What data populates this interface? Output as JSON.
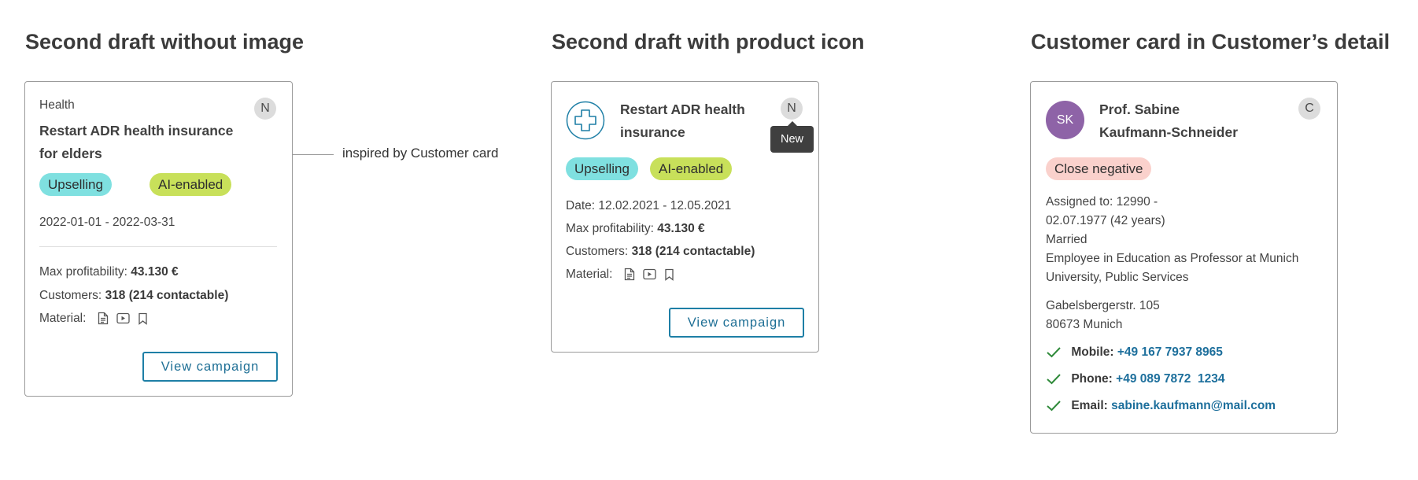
{
  "sections": [
    {
      "title": "Second draft without image"
    },
    {
      "title": "Second draft with product icon"
    },
    {
      "title": "Customer card in Customer’s detail"
    }
  ],
  "annotation": {
    "text": "inspired by Customer card"
  },
  "card1": {
    "category": "Health",
    "badge": "N",
    "title_line1": "Restart ADR health insurance",
    "title_line2": "for elders",
    "tags": [
      "Upselling",
      "AI-enabled"
    ],
    "date_range": "2022-01-01 - 2022-03-31",
    "max_profitability_label": "Max profitability:",
    "max_profitability_value": "43.130 €",
    "customers_label": "Customers:",
    "customers_value": "318 (214 contactable)",
    "material_label": "Material:",
    "material_icons": [
      "document-icon",
      "video-icon",
      "bookmark-icon"
    ],
    "button_label": "View campaign"
  },
  "card2": {
    "product_icon": "medical-cross-icon",
    "title_line1": "Restart ADR health",
    "title_line2": "insurance",
    "badge": "N",
    "tooltip": "New",
    "tags": [
      "Upselling",
      "AI-enabled"
    ],
    "date_label": "Date:",
    "date_value": "12.02.2021 - 12.05.2021",
    "max_profitability_label": "Max profitability:",
    "max_profitability_value": "43.130 €",
    "customers_label": "Customers:",
    "customers_value": "318 (214 contactable)",
    "material_label": "Material:",
    "material_icons": [
      "document-icon",
      "video-icon",
      "bookmark-icon"
    ],
    "button_label": "View campaign"
  },
  "card3": {
    "avatar_initials": "SK",
    "name_line1": "Prof. Sabine",
    "name_line2": "Kaufmann-Schneider",
    "badge": "C",
    "status_tag": "Close negative",
    "assigned_line1": "Assigned to: 12990 -",
    "assigned_line2": "02.07.1977 (42 years)",
    "marital_status": "Married",
    "occupation_line1": "Employee in Education as Professor at Munich",
    "occupation_line2": "University, Public Services",
    "address_line1": "Gabelsbergerstr. 105",
    "address_line2": "80673 Munich",
    "contacts": [
      {
        "label": "Mobile:",
        "value": "+49 167 7937 8965"
      },
      {
        "label": "Phone:",
        "value": "+49 089 7872  1234"
      },
      {
        "label": "Email:",
        "value": "sabine.kaufmann@mail.com"
      }
    ]
  },
  "colors": {
    "accent": "#1e7fa6",
    "upselling_tag": "#7fe0e0",
    "ai_tag": "#c8e05a",
    "negative_tag": "#fad1cc",
    "avatar": "#8e63a7",
    "check": "#2f8a3a"
  }
}
